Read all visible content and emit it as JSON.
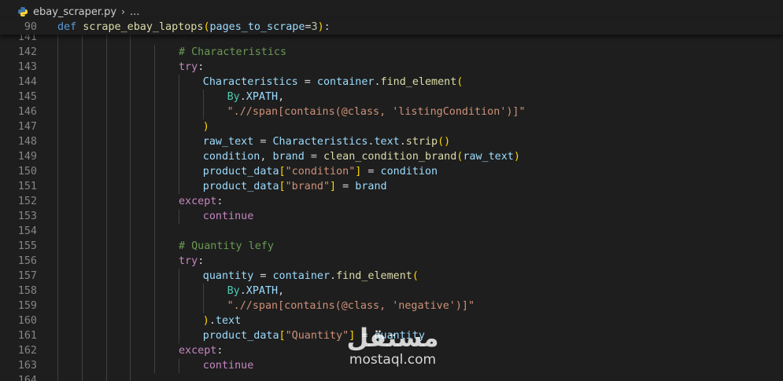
{
  "breadcrumb": {
    "file_icon": "python-file-icon",
    "file_name": "ebay_scraper.py",
    "chevron": "›",
    "more": "..."
  },
  "sticky_scroll": {
    "line_number": "90",
    "tokens": [
      {
        "t": "def",
        "c": "def"
      },
      {
        "t": " ",
        "c": "punc"
      },
      {
        "t": "scrape_ebay_laptops",
        "c": "fn"
      },
      {
        "t": "(",
        "c": "br1"
      },
      {
        "t": "pages_to_scrape",
        "c": "var"
      },
      {
        "t": "=",
        "c": "punc"
      },
      {
        "t": "3",
        "c": "num"
      },
      {
        "t": ")",
        "c": "br1"
      },
      {
        "t": ":",
        "c": "punc"
      }
    ]
  },
  "colors": {
    "background": "#1e1e1e",
    "keyword": "#c586c0",
    "comment": "#6a9955",
    "string": "#ce9178",
    "variable": "#9cdcfe",
    "class": "#4ec9b0",
    "function": "#dcdcaa"
  },
  "lines": [
    {
      "n": "141",
      "indent": 0,
      "guides": 4,
      "tokens": []
    },
    {
      "n": "142",
      "indent": 5,
      "guides": 5,
      "tokens": [
        {
          "t": "# Characteristics",
          "c": "com"
        }
      ]
    },
    {
      "n": "143",
      "indent": 5,
      "guides": 5,
      "tokens": [
        {
          "t": "try",
          "c": "kw"
        },
        {
          "t": ":",
          "c": "punc"
        }
      ]
    },
    {
      "n": "144",
      "indent": 6,
      "guides": 6,
      "tokens": [
        {
          "t": "Characteristics",
          "c": "var"
        },
        {
          "t": " = ",
          "c": "punc"
        },
        {
          "t": "container",
          "c": "var"
        },
        {
          "t": ".",
          "c": "punc"
        },
        {
          "t": "find_element",
          "c": "fn"
        },
        {
          "t": "(",
          "c": "br1"
        }
      ]
    },
    {
      "n": "145",
      "indent": 7,
      "guides": 7,
      "tokens": [
        {
          "t": "By",
          "c": "cls"
        },
        {
          "t": ".",
          "c": "punc"
        },
        {
          "t": "XPATH",
          "c": "var"
        },
        {
          "t": ",",
          "c": "punc"
        }
      ]
    },
    {
      "n": "146",
      "indent": 7,
      "guides": 7,
      "tokens": [
        {
          "t": "\".//span[contains(@class, 'listingCondition')]\"",
          "c": "str"
        }
      ]
    },
    {
      "n": "147",
      "indent": 6,
      "guides": 6,
      "tokens": [
        {
          "t": ")",
          "c": "br1"
        }
      ]
    },
    {
      "n": "148",
      "indent": 6,
      "guides": 6,
      "tokens": [
        {
          "t": "raw_text",
          "c": "var"
        },
        {
          "t": " = ",
          "c": "punc"
        },
        {
          "t": "Characteristics",
          "c": "var"
        },
        {
          "t": ".",
          "c": "punc"
        },
        {
          "t": "text",
          "c": "var"
        },
        {
          "t": ".",
          "c": "punc"
        },
        {
          "t": "strip",
          "c": "fn"
        },
        {
          "t": "()",
          "c": "br1"
        }
      ]
    },
    {
      "n": "149",
      "indent": 6,
      "guides": 6,
      "tokens": [
        {
          "t": "condition",
          "c": "var"
        },
        {
          "t": ", ",
          "c": "punc"
        },
        {
          "t": "brand",
          "c": "var"
        },
        {
          "t": " = ",
          "c": "punc"
        },
        {
          "t": "clean_condition_brand",
          "c": "fn"
        },
        {
          "t": "(",
          "c": "br1"
        },
        {
          "t": "raw_text",
          "c": "var"
        },
        {
          "t": ")",
          "c": "br1"
        }
      ]
    },
    {
      "n": "150",
      "indent": 6,
      "guides": 6,
      "tokens": [
        {
          "t": "product_data",
          "c": "var"
        },
        {
          "t": "[",
          "c": "br1"
        },
        {
          "t": "\"condition\"",
          "c": "str"
        },
        {
          "t": "]",
          "c": "br1"
        },
        {
          "t": " = ",
          "c": "punc"
        },
        {
          "t": "condition",
          "c": "var"
        }
      ]
    },
    {
      "n": "151",
      "indent": 6,
      "guides": 6,
      "tokens": [
        {
          "t": "product_data",
          "c": "var"
        },
        {
          "t": "[",
          "c": "br1"
        },
        {
          "t": "\"brand\"",
          "c": "str"
        },
        {
          "t": "]",
          "c": "br1"
        },
        {
          "t": " = ",
          "c": "punc"
        },
        {
          "t": "brand",
          "c": "var"
        }
      ]
    },
    {
      "n": "152",
      "indent": 5,
      "guides": 5,
      "tokens": [
        {
          "t": "except",
          "c": "kw"
        },
        {
          "t": ":",
          "c": "punc"
        }
      ]
    },
    {
      "n": "153",
      "indent": 6,
      "guides": 6,
      "tokens": [
        {
          "t": "continue",
          "c": "kw"
        }
      ]
    },
    {
      "n": "154",
      "indent": 0,
      "guides": 5,
      "tokens": []
    },
    {
      "n": "155",
      "indent": 5,
      "guides": 5,
      "tokens": [
        {
          "t": "# Quantity lefy",
          "c": "com"
        }
      ]
    },
    {
      "n": "156",
      "indent": 5,
      "guides": 5,
      "tokens": [
        {
          "t": "try",
          "c": "kw"
        },
        {
          "t": ":",
          "c": "punc"
        }
      ]
    },
    {
      "n": "157",
      "indent": 6,
      "guides": 6,
      "tokens": [
        {
          "t": "quantity",
          "c": "var"
        },
        {
          "t": " = ",
          "c": "punc"
        },
        {
          "t": "container",
          "c": "var"
        },
        {
          "t": ".",
          "c": "punc"
        },
        {
          "t": "find_element",
          "c": "fn"
        },
        {
          "t": "(",
          "c": "br1"
        }
      ]
    },
    {
      "n": "158",
      "indent": 7,
      "guides": 7,
      "tokens": [
        {
          "t": "By",
          "c": "cls"
        },
        {
          "t": ".",
          "c": "punc"
        },
        {
          "t": "XPATH",
          "c": "var"
        },
        {
          "t": ",",
          "c": "punc"
        }
      ]
    },
    {
      "n": "159",
      "indent": 7,
      "guides": 7,
      "tokens": [
        {
          "t": "\".//span[contains(@class, 'negative')]\"",
          "c": "str"
        }
      ]
    },
    {
      "n": "160",
      "indent": 6,
      "guides": 6,
      "tokens": [
        {
          "t": ")",
          "c": "br1"
        },
        {
          "t": ".",
          "c": "punc"
        },
        {
          "t": "text",
          "c": "var"
        }
      ]
    },
    {
      "n": "161",
      "indent": 6,
      "guides": 6,
      "tokens": [
        {
          "t": "product_data",
          "c": "var"
        },
        {
          "t": "[",
          "c": "br1"
        },
        {
          "t": "\"Quantity\"",
          "c": "str"
        },
        {
          "t": "]",
          "c": "br1"
        },
        {
          "t": " = ",
          "c": "punc"
        },
        {
          "t": "quantity",
          "c": "var"
        }
      ]
    },
    {
      "n": "162",
      "indent": 5,
      "guides": 5,
      "tokens": [
        {
          "t": "except",
          "c": "kw"
        },
        {
          "t": ":",
          "c": "punc"
        }
      ]
    },
    {
      "n": "163",
      "indent": 6,
      "guides": 6,
      "tokens": [
        {
          "t": "continue",
          "c": "kw"
        }
      ]
    },
    {
      "n": "164",
      "indent": 0,
      "guides": 4,
      "tokens": []
    }
  ],
  "watermark": {
    "arabic": "مستقل",
    "latin": "mostaql.com"
  }
}
